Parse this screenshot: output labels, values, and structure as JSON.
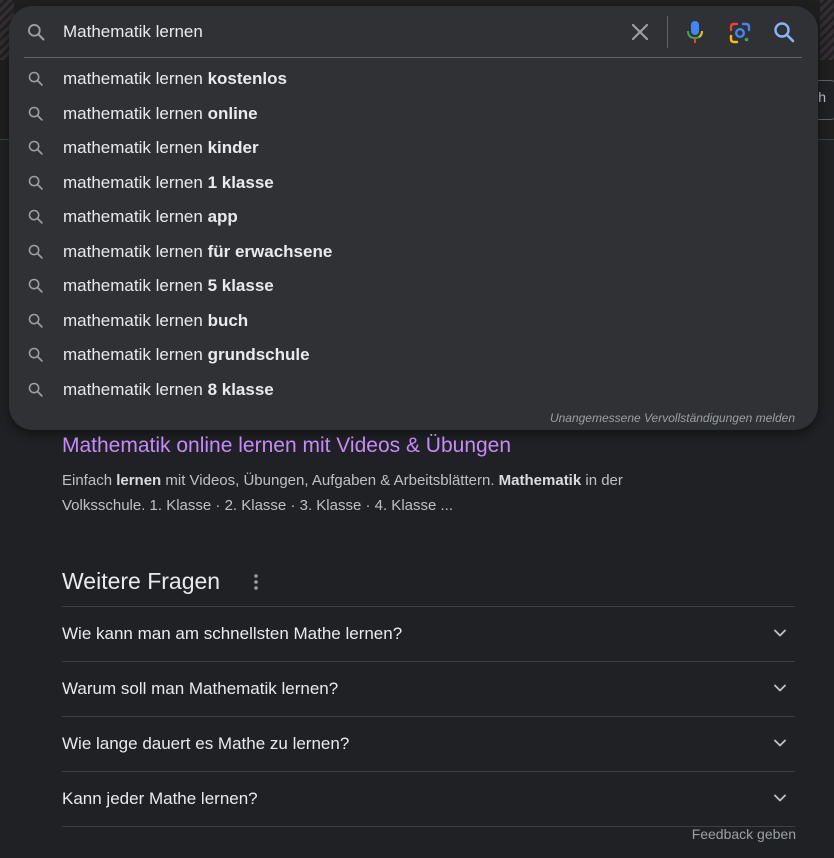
{
  "colors": {
    "page_bg": "#202124",
    "panel_bg": "#303134",
    "text_primary": "#e8eaed",
    "text_secondary": "#bdc1c6",
    "link_visited": "#c58af9",
    "muted": "#9aa0a6"
  },
  "search": {
    "query": "Mathematik lernen",
    "icons": [
      "search-icon",
      "clear-icon",
      "mic-icon",
      "lens-icon",
      "search-submit-icon"
    ]
  },
  "suggestions": [
    {
      "prefix": "mathematik lernen ",
      "bold": "kostenlos"
    },
    {
      "prefix": "mathematik lernen ",
      "bold": "online"
    },
    {
      "prefix": "mathematik lernen ",
      "bold": "kinder"
    },
    {
      "prefix": "mathematik lernen ",
      "bold": "1 klasse"
    },
    {
      "prefix": "mathematik lernen ",
      "bold": "app"
    },
    {
      "prefix": "mathematik lernen ",
      "bold": "für erwachsene"
    },
    {
      "prefix": "mathematik lernen ",
      "bold": "5 klasse"
    },
    {
      "prefix": "mathematik lernen ",
      "bold": "buch"
    },
    {
      "prefix": "mathematik lernen ",
      "bold": "grundschule"
    },
    {
      "prefix": "mathematik lernen ",
      "bold": "8 klasse"
    }
  ],
  "report_link": "Unangemessene Vervollständigungen melden",
  "background_pill_text": "h",
  "result": {
    "title": "Mathematik online lernen mit Videos & Übungen",
    "snippet_parts": [
      {
        "t": "Einfach ",
        "b": false
      },
      {
        "t": "lernen",
        "b": true
      },
      {
        "t": " mit Videos, Übungen, Aufgaben & Arbeitsblättern. ",
        "b": false
      },
      {
        "t": "Mathematik",
        "b": true
      },
      {
        "t": " in der Volksschule. 1. Klasse · 2. Klasse · 3. Klasse · 4. Klasse ...",
        "b": false
      }
    ]
  },
  "questions_section": {
    "title": "Weitere Fragen",
    "items": [
      "Wie kann man am schnellsten Mathe lernen?",
      "Warum soll man Mathematik lernen?",
      "Wie lange dauert es Mathe zu lernen?",
      "Kann jeder Mathe lernen?"
    ]
  },
  "feedback_label": "Feedback geben"
}
